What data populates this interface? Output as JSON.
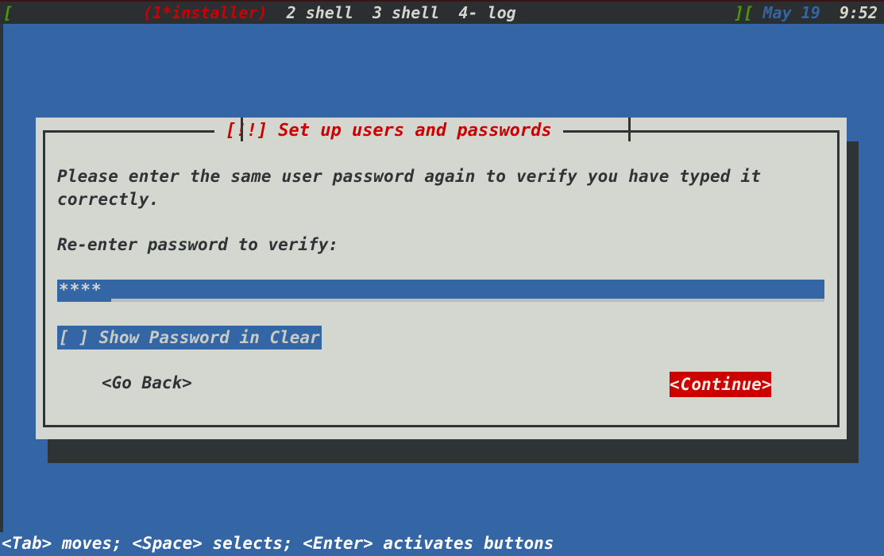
{
  "tmux": {
    "left_bracket": "[",
    "windows": [
      {
        "label": "(1*installer)",
        "active": true
      },
      {
        "label": "2 shell",
        "active": false
      },
      {
        "label": "3 shell",
        "active": false
      },
      {
        "label": "4- log",
        "active": false
      }
    ],
    "windows_text": "(1*installer)  2 shell  3 shell  4- log",
    "right_brackets": "][",
    "date": "May 19",
    "time": "9:52",
    "colors": {
      "bar_bg": "#2b2f31",
      "green": "#4e9a06",
      "red": "#cc0000",
      "blue": "#3465a4",
      "white": "#d3d7cf"
    }
  },
  "dialog": {
    "title": "[!!] Set up users and passwords",
    "intro": "Please enter the same user password again to verify you have typed it correctly.",
    "field_label": "Re-enter password to verify:",
    "password": {
      "value": "****",
      "masked_char": "*",
      "length": 4
    },
    "checkbox": {
      "bracket": "[ ]",
      "label": "Show Password in Clear",
      "text": "[ ] Show Password in Clear",
      "checked": false
    },
    "buttons": {
      "go_back": "<Go Back>",
      "continue_prefix": "<",
      "continue_hotkey": "C",
      "continue_rest": "ontinue>",
      "continue_full": "<Continue>",
      "focused": "continue"
    },
    "colors": {
      "background": "#d3d7cf",
      "border": "#2e3436",
      "title": "#cc0000",
      "field_bg": "#3465a4",
      "button_focus_bg": "#cc0000"
    }
  },
  "help": {
    "text": "<Tab> moves; <Space> selects; <Enter> activates buttons"
  },
  "screen": {
    "backdrop_color": "#3465a4"
  }
}
